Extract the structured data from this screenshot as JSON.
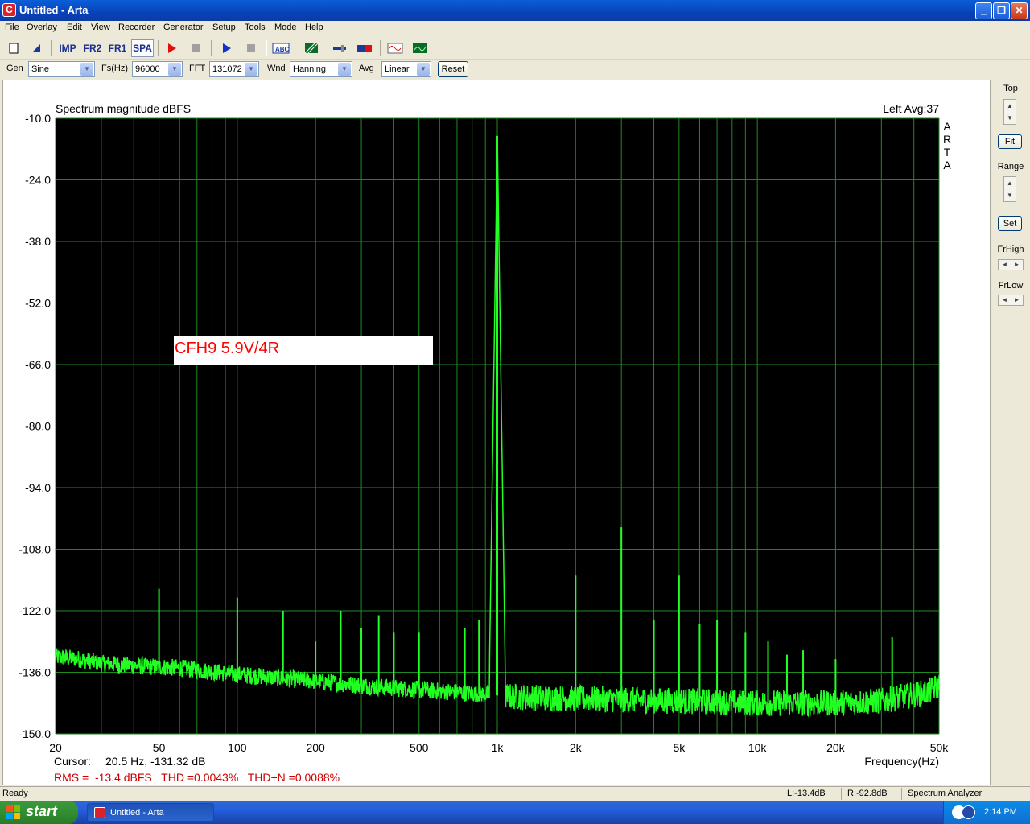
{
  "window": {
    "title": "Untitled - Arta",
    "app_icon": "C",
    "min_glyph": "_",
    "max_glyph": "❐",
    "close_glyph": "✕"
  },
  "menu": [
    "File",
    "Overlay",
    "Edit",
    "View",
    "Recorder",
    "Generator",
    "Setup",
    "Tools",
    "Mode",
    "Help"
  ],
  "toolbar": {
    "imp": "IMP",
    "fr2": "FR2",
    "fr1": "FR1",
    "spa": "SPA",
    "icons": [
      "new-document-icon",
      "open-icon",
      "record-icon",
      "stop-icon",
      "play-icon",
      "stop-icon",
      "abc-icon",
      "hatch-icon",
      "slider-icon",
      "level-meter-icon",
      "sine-wave-icon",
      "scope-icon"
    ]
  },
  "controls": {
    "gen_label": "Gen",
    "gen_value": "Sine",
    "fs_label": "Fs(Hz)",
    "fs_value": "96000",
    "fft_label": "FFT",
    "fft_value": "131072",
    "wnd_label": "Wnd",
    "wnd_value": "Hanning",
    "avg_label": "Avg",
    "avg_value": "Linear",
    "reset_label": "Reset",
    "dropdown_glyph": "▼"
  },
  "side": {
    "top_label": "Top",
    "fit_label": "Fit",
    "range_label": "Range",
    "set_label": "Set",
    "frhigh_label": "FrHigh",
    "frlow_label": "FrLow",
    "up_glyph": "▲",
    "down_glyph": "▼",
    "left_glyph": "◄",
    "right_glyph": "►"
  },
  "chart_data": {
    "type": "line",
    "title": "Spectrum magnitude dBFS",
    "channel_label": "Left  Avg:37",
    "side_text": [
      "A",
      "R",
      "T",
      "A"
    ],
    "xlabel": "Frequency(Hz)",
    "x_scale": "log",
    "xlim": [
      20,
      50000
    ],
    "ylim": [
      -150,
      -10
    ],
    "ytick_values": [
      -10,
      -24,
      -38,
      -52,
      -66,
      -80,
      -94,
      -108,
      -122,
      -136,
      -150
    ],
    "ytick_labels": [
      "-10.0",
      "-24.0",
      "-38.0",
      "-52.0",
      "-66.0",
      "-80.0",
      "-94.0",
      "-108.0",
      "-122.0",
      "-136.0",
      "-150.0"
    ],
    "xtick_values": [
      20,
      50,
      100,
      200,
      500,
      1000,
      2000,
      5000,
      10000,
      20000,
      50000
    ],
    "xtick_labels": [
      "20",
      "50",
      "100",
      "200",
      "500",
      "1k",
      "2k",
      "5k",
      "10k",
      "20k",
      "50k"
    ],
    "grid": true,
    "background": "#000000",
    "grid_color": "#1e8a1e",
    "trace_color": "#22ff22",
    "annotation": "CFH9 5.9V/4R",
    "annotation_color": "#ff0000",
    "cursor_label": "Cursor:",
    "cursor_value": "20.5 Hz, -131.32 dB",
    "measurement": "RMS =  -13.4 dBFS   THD =0.0043%   THD+N =0.0088%",
    "measurement_color": "#cc0000",
    "noise_floor": [
      [
        20,
        -132.5
      ],
      [
        25,
        -133
      ],
      [
        30,
        -134
      ],
      [
        40,
        -134.5
      ],
      [
        60,
        -135
      ],
      [
        100,
        -136.5
      ],
      [
        200,
        -138
      ],
      [
        300,
        -139
      ],
      [
        500,
        -140
      ],
      [
        700,
        -140.5
      ],
      [
        900,
        -141
      ],
      [
        1100,
        -141.5
      ],
      [
        2000,
        -142
      ],
      [
        5000,
        -142.5
      ],
      [
        10000,
        -143
      ],
      [
        20000,
        -143
      ],
      [
        30000,
        -142.5
      ],
      [
        45000,
        -140.5
      ],
      [
        50000,
        -139
      ]
    ],
    "peaks": [
      {
        "f": 50,
        "db": -117
      },
      {
        "f": 100,
        "db": -119
      },
      {
        "f": 150,
        "db": -122
      },
      {
        "f": 200,
        "db": -129
      },
      {
        "f": 250,
        "db": -122
      },
      {
        "f": 300,
        "db": -126
      },
      {
        "f": 350,
        "db": -123
      },
      {
        "f": 400,
        "db": -127
      },
      {
        "f": 500,
        "db": -127
      },
      {
        "f": 750,
        "db": -126
      },
      {
        "f": 850,
        "db": -124
      },
      {
        "f": 1000,
        "db": -14
      },
      {
        "f": 2000,
        "db": -114
      },
      {
        "f": 3000,
        "db": -103
      },
      {
        "f": 4000,
        "db": -124
      },
      {
        "f": 5000,
        "db": -114
      },
      {
        "f": 6000,
        "db": -125
      },
      {
        "f": 7000,
        "db": -124
      },
      {
        "f": 9000,
        "db": -127
      },
      {
        "f": 11000,
        "db": -129
      },
      {
        "f": 13000,
        "db": -132
      },
      {
        "f": 15000,
        "db": -131
      },
      {
        "f": 20000,
        "db": -133
      },
      {
        "f": 33000,
        "db": -128
      }
    ]
  },
  "status": {
    "ready": "Ready",
    "left_level": "L:-13.4dB",
    "right_level": "R:-92.8dB",
    "mode": "Spectrum Analyzer"
  },
  "taskbar": {
    "start_label": "start",
    "task_item": "Untitled - Arta",
    "clock": "2:14 PM"
  }
}
